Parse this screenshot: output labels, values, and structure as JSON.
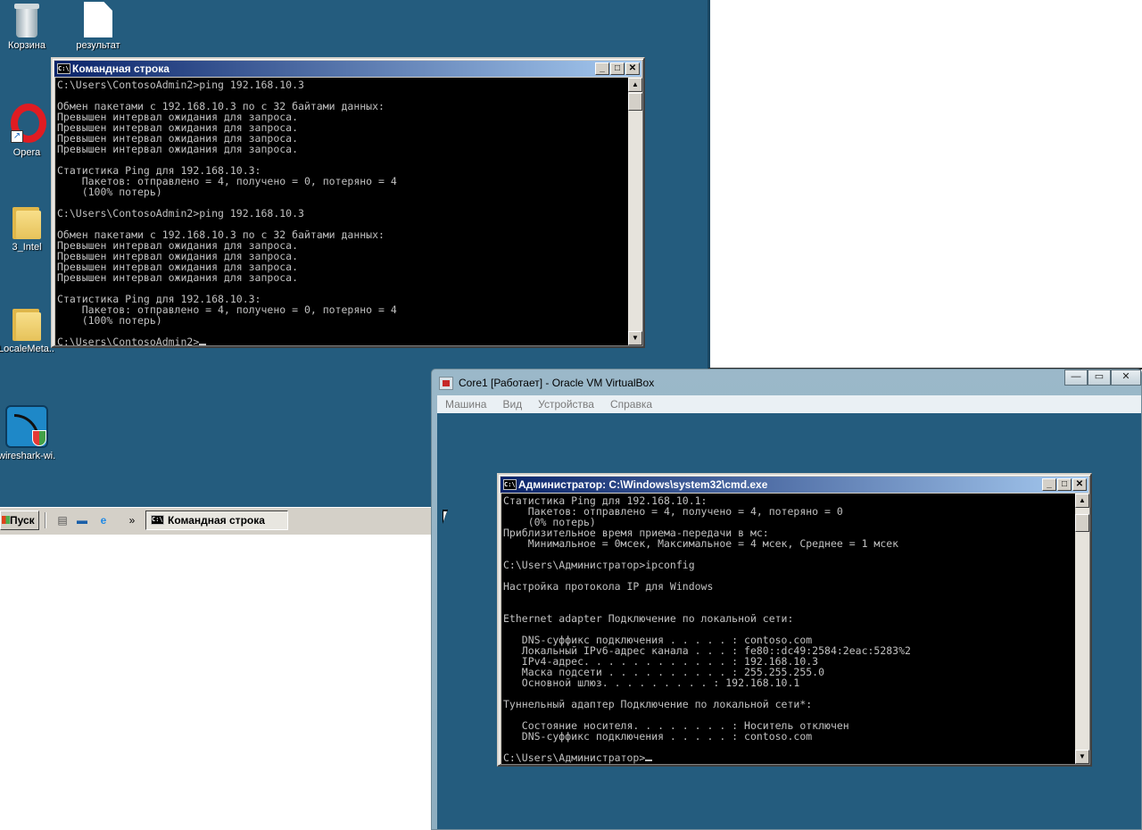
{
  "desktop_icons": [
    {
      "name": "recycle-bin",
      "label": "Корзина"
    },
    {
      "name": "result-file",
      "label": "результат"
    },
    {
      "name": "opera",
      "label": "Opera"
    },
    {
      "name": "folder-intel",
      "label": "3_Intel"
    },
    {
      "name": "folder-locale",
      "label": "LocaleMeta..."
    },
    {
      "name": "wireshark",
      "label": "wireshark-wi..."
    }
  ],
  "taskbar": {
    "start_label": "Пуск",
    "quicklaunch_more": "»",
    "task_label": "Командная строка",
    "task_icon_text": "C:\\"
  },
  "cmd1": {
    "title": "Командная строка",
    "icon_text": "C:\\",
    "buttons": {
      "minimize": "_",
      "maximize": "□",
      "close": "✕"
    },
    "lines": [
      "C:\\Users\\ContosoAdmin2>ping 192.168.10.3",
      "",
      "Обмен пакетами с 192.168.10.3 по с 32 байтами данных:",
      "Превышен интервал ожидания для запроса.",
      "Превышен интервал ожидания для запроса.",
      "Превышен интервал ожидания для запроса.",
      "Превышен интервал ожидания для запроса.",
      "",
      "Статистика Ping для 192.168.10.3:",
      "    Пакетов: отправлено = 4, получено = 0, потеряно = 4",
      "    (100% потерь)",
      "",
      "C:\\Users\\ContosoAdmin2>ping 192.168.10.3",
      "",
      "Обмен пакетами с 192.168.10.3 по с 32 байтами данных:",
      "Превышен интервал ожидания для запроса.",
      "Превышен интервал ожидания для запроса.",
      "Превышен интервал ожидания для запроса.",
      "Превышен интервал ожидания для запроса.",
      "",
      "Статистика Ping для 192.168.10.3:",
      "    Пакетов: отправлено = 4, получено = 0, потеряно = 4",
      "    (100% потерь)",
      "",
      "C:\\Users\\ContosoAdmin2>"
    ]
  },
  "vbox": {
    "title": "Core1 [Работает] - Oracle VM VirtualBox",
    "controls": {
      "minimize": "—",
      "maximize": "▭",
      "close": "✕"
    },
    "menu": [
      "Машина",
      "Вид",
      "Устройства",
      "Справка"
    ]
  },
  "cmd2": {
    "title": "Администратор: C:\\Windows\\system32\\cmd.exe",
    "icon_text": "C:\\",
    "buttons": {
      "minimize": "_",
      "maximize": "□",
      "close": "✕"
    },
    "lines": [
      "Статистика Ping для 192.168.10.1:",
      "    Пакетов: отправлено = 4, получено = 4, потеряно = 0",
      "    (0% потерь)",
      "Приблизительное время приема-передачи в мс:",
      "    Минимальное = 0мсек, Максимальное = 4 мсек, Среднее = 1 мсек",
      "",
      "C:\\Users\\Администратор>ipconfig",
      "",
      "Настройка протокола IP для Windows",
      "",
      "",
      "Ethernet adapter Подключение по локальной сети:",
      "",
      "   DNS-суффикс подключения . . . . . : contoso.com",
      "   Локальный IPv6-адрес канала . . . : fe80::dc49:2584:2eac:5283%2",
      "   IPv4-адрес. . . . . . . . . . . . : 192.168.10.3",
      "   Маска подсети . . . . . . . . . . : 255.255.255.0",
      "   Основной шлюз. . . . . . . . . : 192.168.10.1",
      "",
      "Туннельный адаптер Подключение по локальной сети*:",
      "",
      "   Состояние носителя. . . . . . . . : Носитель отключен",
      "   DNS-суффикс подключения . . . . . : contoso.com",
      "",
      "C:\\Users\\Администратор>"
    ]
  },
  "scroll": {
    "up": "▲",
    "down": "▼"
  },
  "colors": {
    "desktop": "#245c7e",
    "console_bg": "#000000",
    "console_fg": "#c0c0c0",
    "titlebar_start": "#0a246a",
    "titlebar_end": "#a6caf0"
  }
}
